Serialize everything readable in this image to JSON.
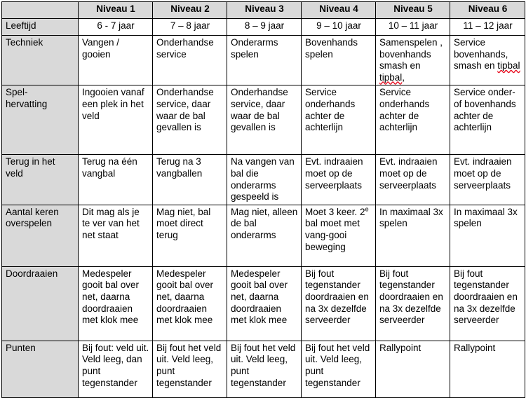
{
  "document": {
    "type": "table",
    "title": "Niveau-overzicht volleybal techniek en spelregels",
    "header_background": "#d9d9d9",
    "border_color": "#000000"
  },
  "table": {
    "corner_label": "",
    "columns": [
      {
        "key": "lvl1",
        "label": "Niveau 1"
      },
      {
        "key": "lvl2",
        "label": "Niveau 2"
      },
      {
        "key": "lvl3",
        "label": "Niveau 3"
      },
      {
        "key": "lvl4",
        "label": "Niveau 4"
      },
      {
        "key": "lvl5",
        "label": "Niveau 5"
      },
      {
        "key": "lvl6",
        "label": "Niveau 6"
      }
    ],
    "rows": [
      {
        "key": "leeftijd",
        "label": "Leeftijd",
        "cells": [
          "6 - 7 jaar",
          "7 – 8 jaar",
          "8 – 9 jaar",
          "9 – 10 jaar",
          "10 – 11 jaar",
          "11 – 12 jaar"
        ]
      },
      {
        "key": "techniek",
        "label": "Techniek",
        "cells": [
          "Vangen / gooien",
          "Onderhandse service",
          "Onderarms spelen",
          "Bovenhands spelen",
          "Samenspelen , bovenhands smash en tipbal,",
          "Service bovenhands, smash en tipbal"
        ]
      },
      {
        "key": "spelhervatting",
        "label": "Spel- hervatting",
        "cells": [
          "Ingooien vanaf een plek in het veld",
          "Onderhandse service, daar waar de bal gevallen is",
          "Onderhandse service, daar waar de bal gevallen is",
          "Service onderhands achter de achterlijn",
          "Service onderhands achter de achterlijn",
          "Service onder- of bovenhands achter de achterlijn"
        ]
      },
      {
        "key": "terug_in_het_veld",
        "label": "Terug in het veld",
        "cells": [
          "Terug na één vangbal",
          "Terug na 3 vangballen",
          "Na vangen van bal die onderarms gespeeld is",
          "Evt. indraaien moet op de serveerplaats",
          "Evt. indraaien moet op de serveerplaats",
          "Evt. indraaien moet op de serveerplaats"
        ]
      },
      {
        "key": "aantal_keren_overspelen",
        "label": "Aantal keren overspelen",
        "cells": [
          "Dit mag als je te ver van het net staat",
          "Mag niet, bal moet direct terug",
          "Mag niet, alleen de bal onderarms",
          "Moet 3 keer. 2e bal moet met vang-gooi beweging",
          "In maximaal 3x spelen",
          "In maximaal 3x spelen"
        ]
      },
      {
        "key": "doordraaien",
        "label": "Doordraaien",
        "cells": [
          "Medespeler gooit bal over net, daarna doordraaien met klok mee",
          "Medespeler gooit bal over net, daarna doordraaien met klok mee",
          "Medespeler gooit bal over net, daarna doordraaien met klok mee",
          "Bij fout tegenstander doordraaien en na 3x dezelfde serveerder",
          "Bij fout tegenstander doordraaien en na 3x dezelfde serveerder",
          "Bij fout tegenstander doordraaien en na 3x dezelfde serveerder"
        ]
      },
      {
        "key": "punten",
        "label": "Punten",
        "cells": [
          "Bij fout: veld uit. Veld leeg, dan punt tegenstander",
          "Bij fout het veld uit. Veld leeg, punt tegenstander",
          "Bij fout het veld uit. Veld leeg, punt tegenstander",
          "Bij fout het veld uit. Veld leeg, punt tegenstander",
          "Rallypoint",
          "Rallypoint"
        ]
      }
    ]
  },
  "rich_cells": {
    "techniek_lvl5": {
      "parts": [
        {
          "text": "Samenspelen , bovenhands smash en "
        },
        {
          "text": "tipbal",
          "spellcheck": true
        },
        {
          "text": ","
        }
      ]
    },
    "techniek_lvl6": {
      "parts": [
        {
          "text": "Service bovenhands, smash en "
        },
        {
          "text": "tipbal",
          "spellcheck": true
        }
      ]
    },
    "spelhervatting_label": {
      "lines": [
        "Spel-",
        "hervatting"
      ]
    },
    "aantal_lvl4": {
      "parts": [
        {
          "text": "Moet 3 keer. 2"
        },
        {
          "text": "e",
          "superscript": true
        },
        {
          "text": " bal moet met vang-gooi beweging"
        }
      ]
    }
  }
}
